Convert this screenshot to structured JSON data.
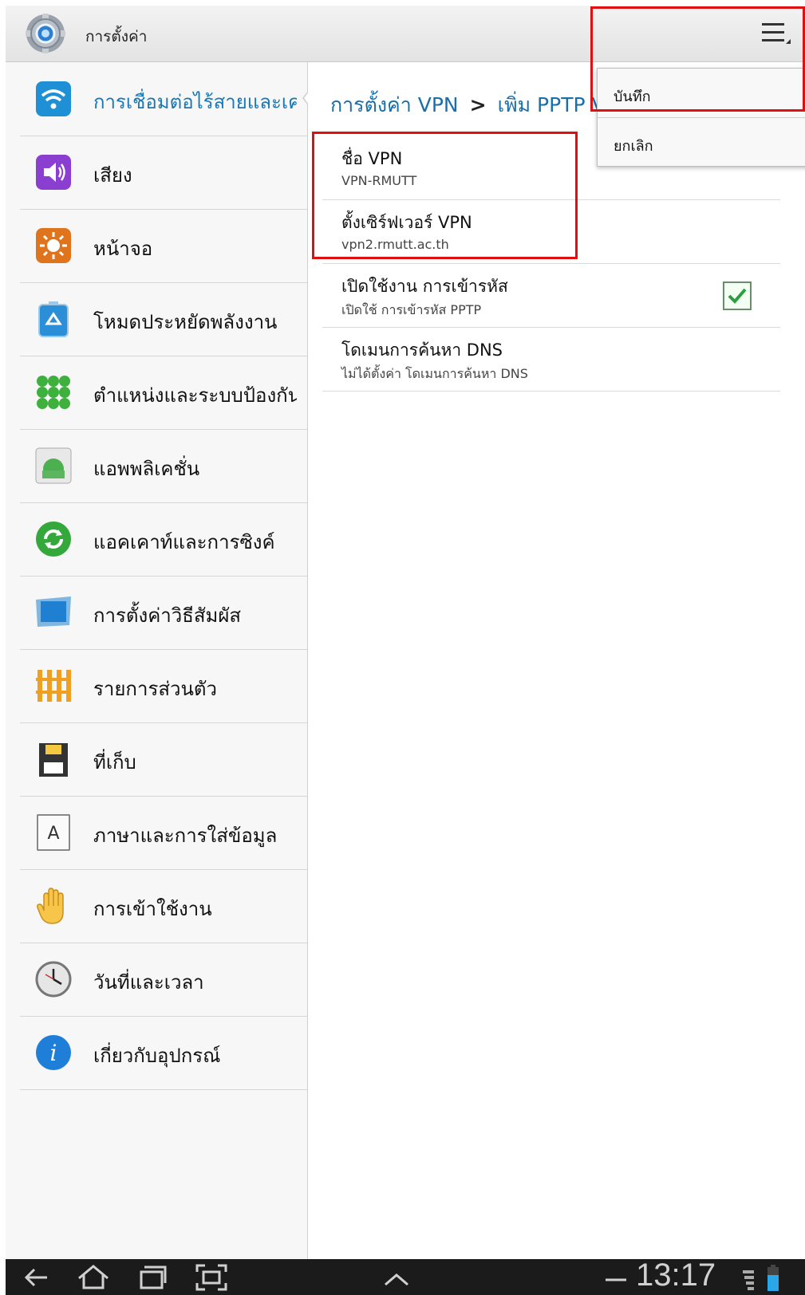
{
  "app": {
    "title": "การตั้งค่า"
  },
  "colors": {
    "accent": "#1a78b6",
    "highlight": "#e01010",
    "navbar": "#1b1b1b"
  },
  "sidebar": {
    "items": [
      {
        "label": "การเชื่อมต่อไร้สายและเครือข่าย",
        "icon": "wifi-icon",
        "selected": true
      },
      {
        "label": "เสียง",
        "icon": "speaker-icon"
      },
      {
        "label": "หน้าจอ",
        "icon": "brightness-icon"
      },
      {
        "label": "โหมดประหยัดพลังงาน",
        "icon": "power-saving-icon"
      },
      {
        "label": "ตำแหน่งและระบบป้องกัน",
        "icon": "location-security-icon"
      },
      {
        "label": "แอพพลิเคชั่น",
        "icon": "android-icon"
      },
      {
        "label": "แอคเคาท์และการซิงค์",
        "icon": "sync-icon"
      },
      {
        "label": "การตั้งค่าวิธีสัมผัส",
        "icon": "motion-icon"
      },
      {
        "label": "รายการส่วนตัว",
        "icon": "privacy-icon"
      },
      {
        "label": "ที่เก็บ",
        "icon": "storage-icon"
      },
      {
        "label": "ภาษาและการใส่ข้อมูล",
        "icon": "language-icon"
      },
      {
        "label": "การเข้าใช้งาน",
        "icon": "hand-icon"
      },
      {
        "label": "วันที่และเวลา",
        "icon": "clock-icon"
      },
      {
        "label": "เกี่ยวกับอุปกรณ์",
        "icon": "info-icon"
      }
    ]
  },
  "main": {
    "breadcrumb": {
      "parent": "การตั้งค่า VPN",
      "separator": ">",
      "current": "เพิ่ม PPTP VPN"
    },
    "items": [
      {
        "title": "ชื่อ VPN",
        "summary": "VPN-RMUTT"
      },
      {
        "title": "ตั้งเซิร์ฟเวอร์ VPN",
        "summary": "vpn2.rmutt.ac.th"
      },
      {
        "title": "เปิดใช้งาน การเข้ารหัส",
        "summary": "เปิดใช้ การเข้ารหัส PPTP",
        "checked": true
      },
      {
        "title": "โดเมนการค้นหา DNS",
        "summary": "ไม่ได้ตั้งค่า โดเมนการค้นหา DNS"
      }
    ]
  },
  "menu": {
    "items": [
      "บันทึก",
      "ยกเลิก"
    ]
  },
  "statusbar": {
    "time": "13:17"
  }
}
